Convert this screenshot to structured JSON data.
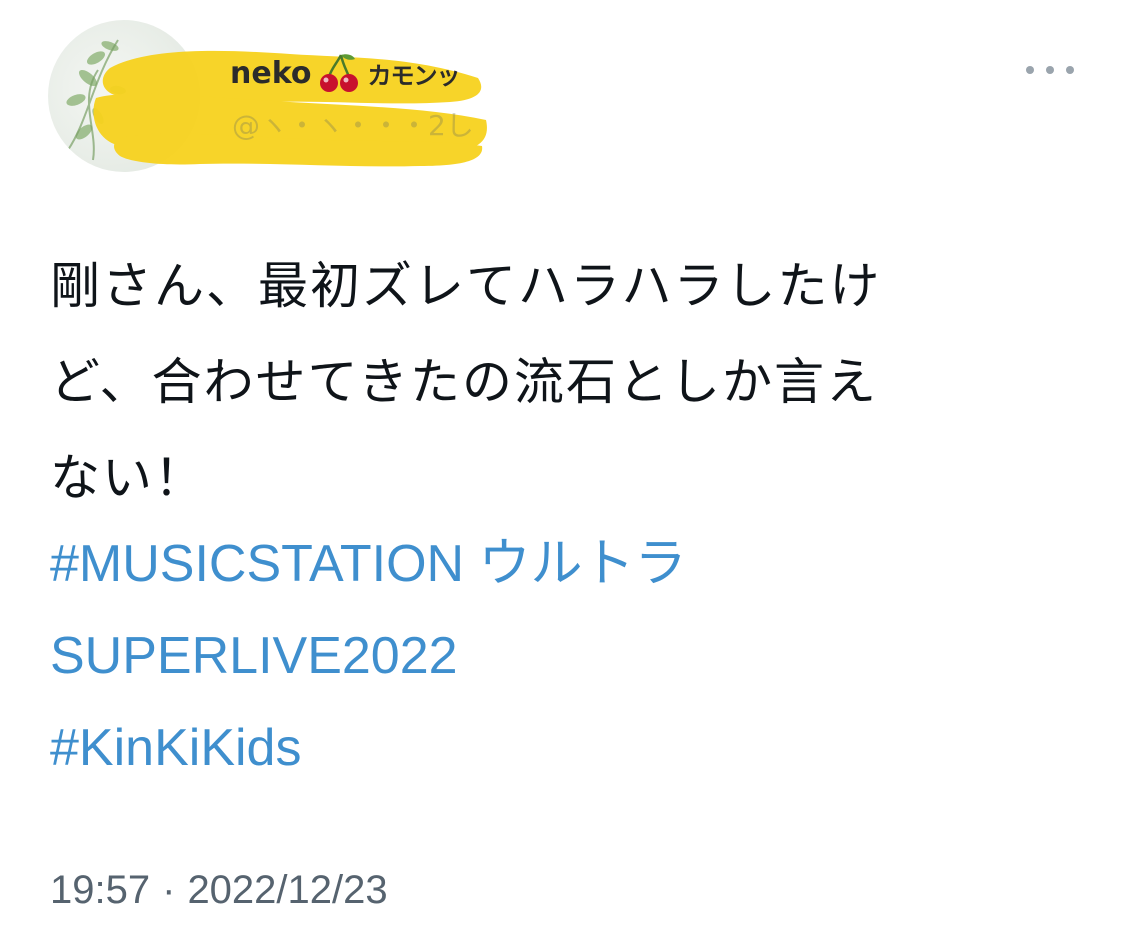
{
  "user": {
    "display_name": "neko",
    "display_suffix": "カモンッ",
    "handle": "@ヽ・ヽ・・・2し"
  },
  "tweet": {
    "text_lines": [
      "剛さん、最初ズレてハラハラしたけ",
      "ど、合わせてきたの流石としか言え",
      "ない！"
    ],
    "hashtag_lines": [
      " #MUSICSTATION ウルトラ",
      "SUPERLIVE2022",
      " #KinKiKids"
    ],
    "time": "19:57",
    "separator": "·",
    "date": "2022/12/23"
  },
  "icons": {
    "more": "more-dots-icon",
    "name_emoji": "cherry-icon",
    "avatar": "avatar-plant-photo"
  },
  "colors": {
    "hashtag": "#3f8fce",
    "text": "#0f1419",
    "timestamp": "#56636f",
    "redaction": "#f7d21e"
  }
}
